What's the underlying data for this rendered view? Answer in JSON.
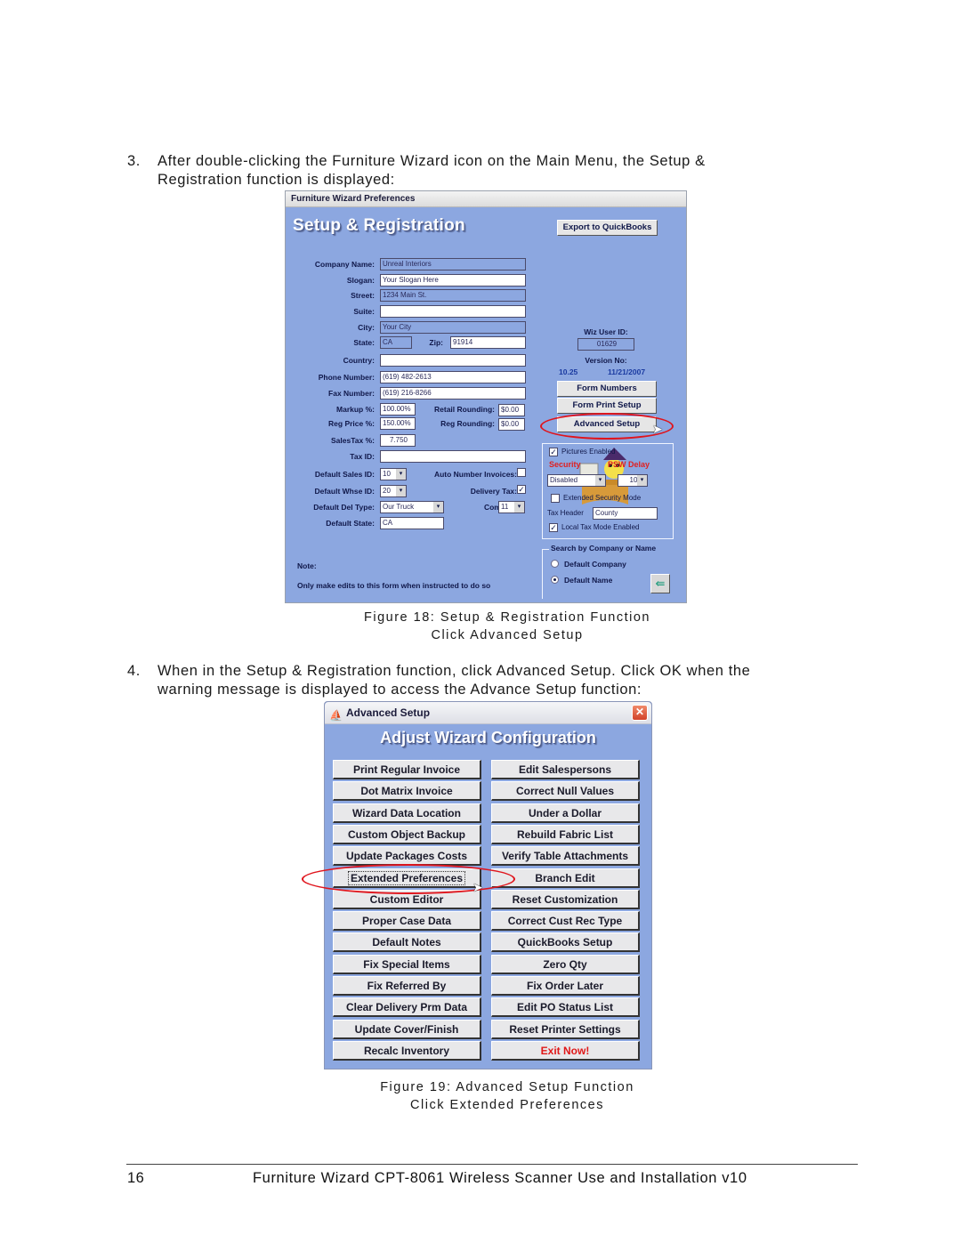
{
  "steps": [
    {
      "number": "3.",
      "lines": [
        "After double-clicking the Furniture Wizard icon on the Main Menu, the Setup &",
        "Registration function is displayed:"
      ]
    },
    {
      "number": "4.",
      "lines": [
        "When in the Setup & Registration function, click Advanced Setup. Click OK when the",
        "warning message is displayed to access the Advance Setup function:"
      ]
    }
  ],
  "figure18": {
    "caption_line1": "Figure 18: Setup & Registration Function",
    "caption_line2": "Click Advanced Setup",
    "window_title": "Furniture Wizard Preferences",
    "heading": "Setup & Registration",
    "export_button": "Export to QuickBooks",
    "fields": {
      "company_name": {
        "label": "Company Name:",
        "value": "Unreal Interiors"
      },
      "slogan": {
        "label": "Slogan:",
        "value": "Your Slogan Here"
      },
      "street": {
        "label": "Street:",
        "value": "1234 Main St."
      },
      "suite": {
        "label": "Suite:",
        "value": ""
      },
      "city": {
        "label": "City:",
        "value": "Your City"
      },
      "state": {
        "label": "State:",
        "value": "CA"
      },
      "zip": {
        "label": "Zip:",
        "value": "91914"
      },
      "country": {
        "label": "Country:",
        "value": ""
      },
      "phone": {
        "label": "Phone Number:",
        "value": "(619) 482-2613"
      },
      "fax": {
        "label": "Fax Number:",
        "value": "(619) 216-8266"
      },
      "markup": {
        "label": "Markup %:",
        "value": "100.00%"
      },
      "reg_price": {
        "label": "Reg Price %:",
        "value": "150.00%"
      },
      "retail_rounding": {
        "label": "Retail Rounding:",
        "value": "$0.00"
      },
      "reg_rounding": {
        "label": "Reg Rounding:",
        "value": "$0.00"
      },
      "sales_tax": {
        "label": "SalesTax %:",
        "value": "7.750"
      },
      "tax_id": {
        "label": "Tax ID:",
        "value": ""
      },
      "default_sales_id": {
        "label": "Default Sales ID:",
        "value": "10"
      },
      "auto_number_invoices": {
        "label": "Auto Number Invoices:",
        "checked": false
      },
      "default_whse_id": {
        "label": "Default Whse ID:",
        "value": "20"
      },
      "delivery_tax": {
        "label": "Delivery Tax:",
        "checked": true
      },
      "default_del_type": {
        "label": "Default Del Type:",
        "value": "Our Truck"
      },
      "com_plan": {
        "label": "Com Plan:",
        "value": "11"
      },
      "default_state": {
        "label": "Default State:",
        "value": "CA"
      }
    },
    "note_label": "Note:",
    "note_text": "Only make edits to this form when instructed to do so",
    "wiz_user_id_label": "Wiz User ID:",
    "wiz_user_id": "01629",
    "version_label": "Version No:",
    "version": "10.25",
    "version_date": "11/21/2007",
    "buttons": [
      "Form Numbers",
      "Form Print Setup",
      "Advanced Setup"
    ],
    "options": {
      "pictures_enabled_label": "Pictures Enabled",
      "pictures_enabled": true,
      "security_label": "Security",
      "security_value": "Disabled",
      "psw_delay_label": "PSW Delay",
      "psw_delay_value": "10",
      "extended_security_label": "Extended Security Mode",
      "extended_security": false,
      "tax_header_label": "Tax Header",
      "tax_header_value": "County",
      "local_tax_label": "Local Tax Mode Enabled",
      "local_tax": true
    },
    "search": {
      "group_label": "Search by Company or Name",
      "options": [
        "Default Company",
        "Default Name"
      ],
      "selected": "Default Name"
    },
    "icons": {
      "mascot": "wizard-mascot-icon",
      "exit": "exit-door-icon"
    }
  },
  "figure19": {
    "caption_line1": "Figure 19: Advanced Setup Function",
    "caption_line2": "Click Extended Preferences",
    "window_title": "Advanced Setup",
    "heading": "Adjust Wizard Configuration",
    "left_buttons": [
      "Print Regular Invoice",
      "Dot Matrix Invoice",
      "Wizard Data Location",
      "Custom Object Backup",
      "Update Packages Costs",
      "Extended Preferences",
      "Custom Editor",
      "Proper Case Data",
      "Default Notes",
      "Fix Special Items",
      "Fix Referred By",
      "Clear Delivery Prm Data",
      "Update Cover/Finish",
      "Recalc Inventory"
    ],
    "right_buttons": [
      "Edit Salespersons",
      "Correct Null Values",
      "Under a Dollar",
      "Rebuild Fabric List",
      "Verify Table Attachments",
      "Branch Edit",
      "Reset Customization",
      "Correct Cust Rec Type",
      "QuickBooks Setup",
      "Zero Qty",
      "Fix Order Later",
      "Edit PO Status List",
      "Reset Printer Settings",
      "Exit Now!"
    ],
    "highlighted": "Extended Preferences",
    "danger_color": "#e01818"
  },
  "footer": {
    "page_number": "16",
    "title": "Furniture Wizard CPT-8061 Wireless Scanner Use and Installation v10"
  },
  "colors": {
    "form_background": "#8ca7e0",
    "highlight_ellipse": "#e0141c",
    "label_text": "#10184a"
  }
}
